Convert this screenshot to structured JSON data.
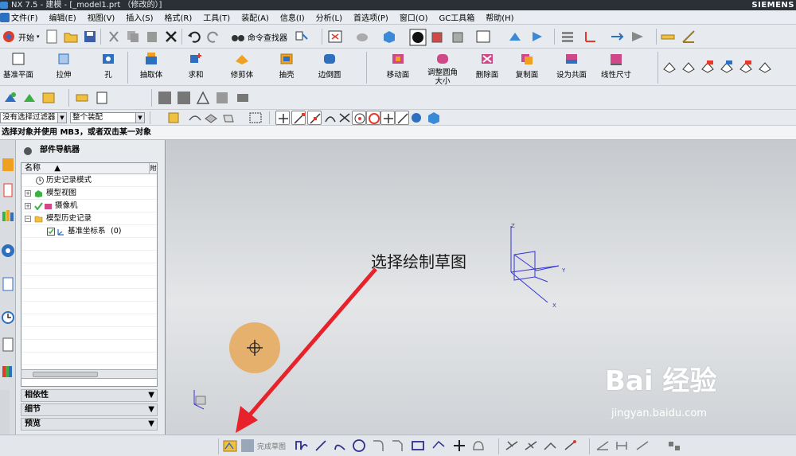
{
  "window": {
    "app_title": "NX 7.5 - 建模 - [_model1.prt （修改的）]",
    "brand": "SIEMENS"
  },
  "menu": [
    "文件(F)",
    "编辑(E)",
    "视图(V)",
    "插入(S)",
    "格式(R)",
    "工具(T)",
    "装配(A)",
    "信息(I)",
    "分析(L)",
    "首选项(P)",
    "窗口(O)",
    "GC工具箱",
    "帮助(H)"
  ],
  "toolbar_standard": {
    "start_label": "开始",
    "command_finder_label": "命令查找器"
  },
  "toolbar_features": [
    "基准平面",
    "拉伸",
    "孔",
    "抽取体",
    "求和",
    "修剪体",
    "抽壳",
    "边倒圆"
  ],
  "toolbar_sync": [
    "移动面",
    "调整圆角大小",
    "删除面",
    "复制面",
    "设为共面",
    "线性尺寸"
  ],
  "selection": {
    "filter_value": "没有选择过滤器",
    "scope_value": "整个装配"
  },
  "status": {
    "prompt": "选择对象并使用 MB3，或者双击某一对象"
  },
  "navigator": {
    "title": "部件导航器",
    "col_name": "名称",
    "col_sort": "▲",
    "col_extra": "附",
    "items": [
      {
        "label": "历史记录模式"
      },
      {
        "label": "模型视图"
      },
      {
        "label": "摄像机"
      },
      {
        "label": "模型历史记录"
      },
      {
        "label": "基准坐标系",
        "suffix": "(0)"
      }
    ],
    "sections": [
      "相依性",
      "细节",
      "预览"
    ]
  },
  "viewport": {
    "annotation": "选择绘制草图",
    "axis_labels": {
      "x": "X",
      "y": "Y",
      "z": "Z"
    }
  },
  "sketch_toolbar": {
    "finish_label": "完成草图"
  },
  "watermark": {
    "logo": "Bai  经验",
    "url": "jingyan.baidu.com"
  },
  "colors": {
    "annotation_arrow": "#e8222a",
    "csys_blue": "#3434d8",
    "cursor_highlight": "#e8a046",
    "accent_icon_orange": "#f0a020",
    "accent_icon_blue": "#2e6fbf"
  }
}
